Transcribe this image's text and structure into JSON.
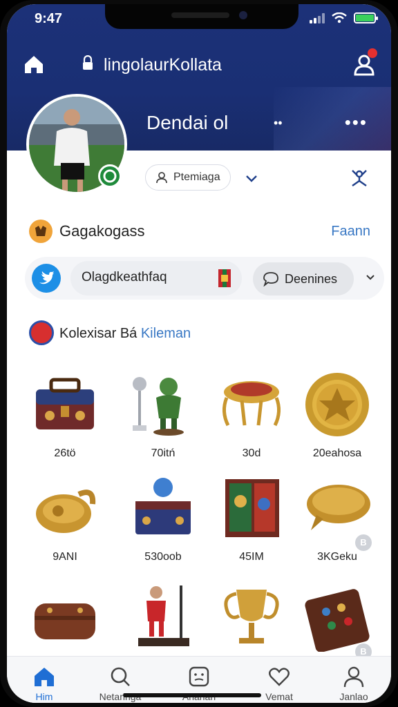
{
  "status_bar": {
    "time": "9:47"
  },
  "header": {
    "site_title": "lingolaurKollata",
    "profile_name": "Dendai ol",
    "small_dots": "••",
    "more_dots": "•••"
  },
  "profile": {
    "pill_label": "Ptemiaga"
  },
  "section1": {
    "title": "Gagakogass",
    "link": "Faann",
    "field_text": "Olagdkeathfaq",
    "button_label": "Deenines"
  },
  "section2": {
    "title": "Kolexisar Bá",
    "title_accent": "Kileman"
  },
  "collection": [
    {
      "label": "26tö",
      "icon": "chest-icon"
    },
    {
      "label": "70itń",
      "icon": "trophy-figure-icon"
    },
    {
      "label": "30d",
      "icon": "golden-ornament-icon"
    },
    {
      "label": "20eahosa",
      "icon": "gold-medal-icon"
    },
    {
      "label": "9ANI",
      "icon": "golden-helmet-icon"
    },
    {
      "label": "530oob",
      "icon": "figure-box-icon"
    },
    {
      "label": "45IM",
      "icon": "painted-cube-icon"
    },
    {
      "label": "3KGeku",
      "icon": "golden-plate-icon"
    },
    {
      "label": "",
      "icon": "leather-case-icon"
    },
    {
      "label": "",
      "icon": "player-statue-icon"
    },
    {
      "label": "",
      "icon": "golden-cup-icon"
    },
    {
      "label": "",
      "icon": "badge-book-icon"
    }
  ],
  "coin_marker": "B",
  "bottom_nav": [
    {
      "label": "Him",
      "icon": "home-icon",
      "active": true
    },
    {
      "label": "Netaringa",
      "icon": "search-icon",
      "active": false
    },
    {
      "label": "Ananan",
      "icon": "face-icon",
      "active": false
    },
    {
      "label": "Vemat",
      "icon": "heart-icon",
      "active": false
    },
    {
      "label": "Janlao",
      "icon": "profile-icon",
      "active": false
    }
  ],
  "colors": {
    "header_blue": "#1c3178",
    "accent_blue": "#3978c4",
    "nav_active": "#1f6ed4"
  }
}
